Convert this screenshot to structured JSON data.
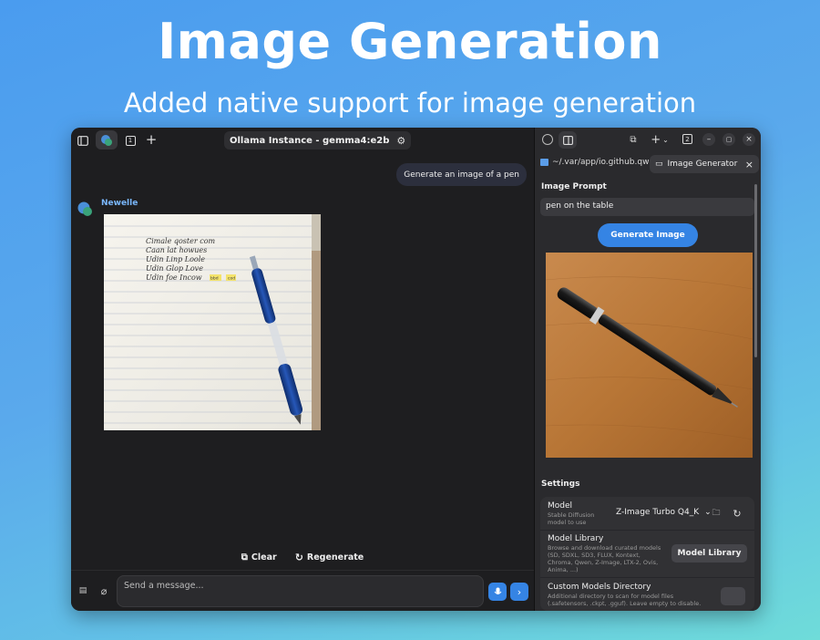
{
  "hero": {
    "title": "Image Generation",
    "subtitle": "Added native support for image generation"
  },
  "left_header": {
    "title_pill": "Ollama Instance - gemma4:e2b",
    "tab_count": "1"
  },
  "chat": {
    "user_message": "Generate an image of a pen",
    "bot_name": "Newelle",
    "notebook_lines": [
      "Cimale qoster com",
      "Caan lat howues",
      "Udin Linp Loole",
      "Udin Glop Love",
      "Udin foe Incow"
    ],
    "notebook_highlights": [
      "bbd",
      "cod"
    ],
    "clear_label": "Clear",
    "regenerate_label": "Regenerate",
    "input_placeholder": "Send a message..."
  },
  "right_header": {
    "tab_count": "2",
    "path_tab": "~/.var/app/io.github.qwe",
    "active_tab": "Image Generator"
  },
  "image_gen": {
    "prompt_label": "Image Prompt",
    "prompt_value": "pen on the table",
    "generate_label": "Generate Image"
  },
  "settings": {
    "label": "Settings",
    "model_title": "Model",
    "model_desc_1": "Stable Diffusion",
    "model_desc_2": "model to use",
    "model_value": "Z-Image Turbo Q4_K",
    "library_title": "Model Library",
    "library_desc_1": "Browse and download curated models",
    "library_desc_2": "(SD, SDXL, SD3, FLUX, Kontext,",
    "library_desc_3": "Chroma, Qwen, Z-Image, LTX-2, Ovis,",
    "library_desc_4": "Anima, ...)",
    "library_button": "Model Library",
    "custom_title": "Custom Models Directory",
    "custom_desc_1": "Additional directory to scan for model files",
    "custom_desc_2": "(.safetensors, .ckpt, .gguf). Leave empty to disable."
  },
  "colors": {
    "accent": "#3584e4",
    "window_bg": "#1e1e20",
    "panel_bg": "#2a2a2d",
    "bot_name": "#7ab8ff"
  }
}
